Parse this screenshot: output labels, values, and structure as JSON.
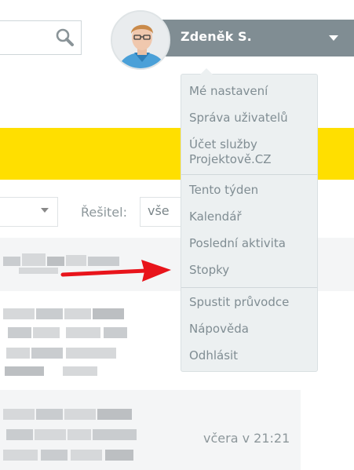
{
  "header": {
    "user_name": "Zdeněk S."
  },
  "filters": {
    "resitel_label": "Řešitel:",
    "resitel_value": "vše"
  },
  "user_menu": {
    "items": [
      {
        "label": "Mé nastavení"
      },
      {
        "label": "Správa uživatelů"
      },
      {
        "label": "Účet služby\nProjektově.CZ"
      },
      {
        "label": "Tento týden"
      },
      {
        "label": "Kalendář"
      },
      {
        "label": "Poslední aktivita"
      },
      {
        "label": "Stopky"
      },
      {
        "label": "Spustit průvodce"
      },
      {
        "label": "Nápověda"
      },
      {
        "label": "Odhlásit"
      }
    ]
  },
  "activity": {
    "timestamp": "včera v 21:21"
  },
  "colors": {
    "header_bar": "#808d93",
    "banner": "#ffdf00",
    "menu_bg": "#ecf0f1",
    "menu_text": "#808d93",
    "annotation_arrow": "#e8141b"
  },
  "icons": {
    "search": "search-icon",
    "menu_toggle": "chevron-down-icon",
    "select_toggle": "chevron-down-icon"
  }
}
